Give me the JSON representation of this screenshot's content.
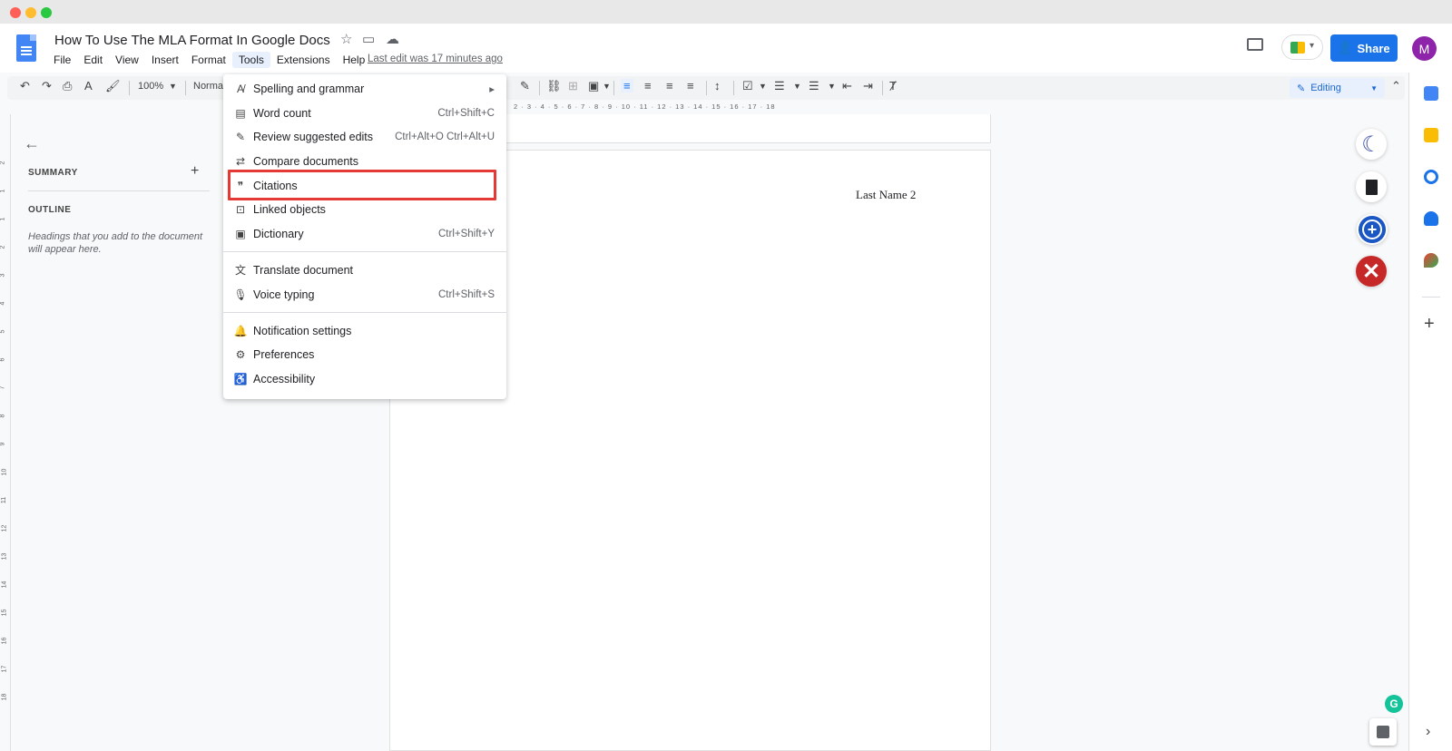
{
  "document": {
    "title": "How To Use The MLA Format In Google Docs",
    "last_edit": "Last edit was 17 minutes ago",
    "header_text": "Last Name 2"
  },
  "menubar": [
    "File",
    "Edit",
    "View",
    "Insert",
    "Format",
    "Tools",
    "Extensions",
    "Help"
  ],
  "header": {
    "share_label": "Share",
    "avatar_initial": "M"
  },
  "toolbar": {
    "zoom": "100%",
    "style": "Normal",
    "mode": "Editing"
  },
  "ruler": {
    "marks": "2 · 3 · 4 · 5 · 6 · 7 · 8 · 9 · 10 · 11 · 12 · 13 · 14 · 15 · 16 · 17 · 18"
  },
  "vertical_ruler": [
    "2",
    "1",
    "1",
    "2",
    "3",
    "4",
    "5",
    "6",
    "7",
    "8",
    "9",
    "10",
    "11",
    "12",
    "13",
    "14",
    "15",
    "16",
    "17",
    "18"
  ],
  "outline_panel": {
    "summary_label": "SUMMARY",
    "outline_label": "OUTLINE",
    "hint": "Headings that you add to the document will appear here."
  },
  "tools_menu": {
    "groups": [
      [
        {
          "icon": "spellcheck-icon",
          "label": "Spelling and grammar",
          "shortcut": "▸"
        },
        {
          "icon": "word-count-icon",
          "label": "Word count",
          "shortcut": "Ctrl+Shift+C"
        },
        {
          "icon": "review-edits-icon",
          "label": "Review suggested edits",
          "shortcut": "Ctrl+Alt+O Ctrl+Alt+U"
        },
        {
          "icon": "compare-icon",
          "label": "Compare documents",
          "shortcut": ""
        },
        {
          "icon": "quote-icon",
          "label": "Citations",
          "shortcut": ""
        },
        {
          "icon": "linked-objects-icon",
          "label": "Linked objects",
          "shortcut": ""
        },
        {
          "icon": "dictionary-icon",
          "label": "Dictionary",
          "shortcut": "Ctrl+Shift+Y"
        }
      ],
      [
        {
          "icon": "translate-icon",
          "label": "Translate document",
          "shortcut": ""
        },
        {
          "icon": "microphone-icon",
          "label": "Voice typing",
          "shortcut": "Ctrl+Shift+S"
        }
      ],
      [
        {
          "icon": "bell-icon",
          "label": "Notification settings",
          "shortcut": ""
        },
        {
          "icon": "preferences-icon",
          "label": "Preferences",
          "shortcut": ""
        },
        {
          "icon": "accessibility-icon",
          "label": "Accessibility",
          "shortcut": ""
        }
      ]
    ],
    "highlighted_item": "Citations"
  },
  "colors": {
    "accent": "#1a73e8",
    "highlight": "#e53935",
    "avatar": "#8e24aa"
  }
}
